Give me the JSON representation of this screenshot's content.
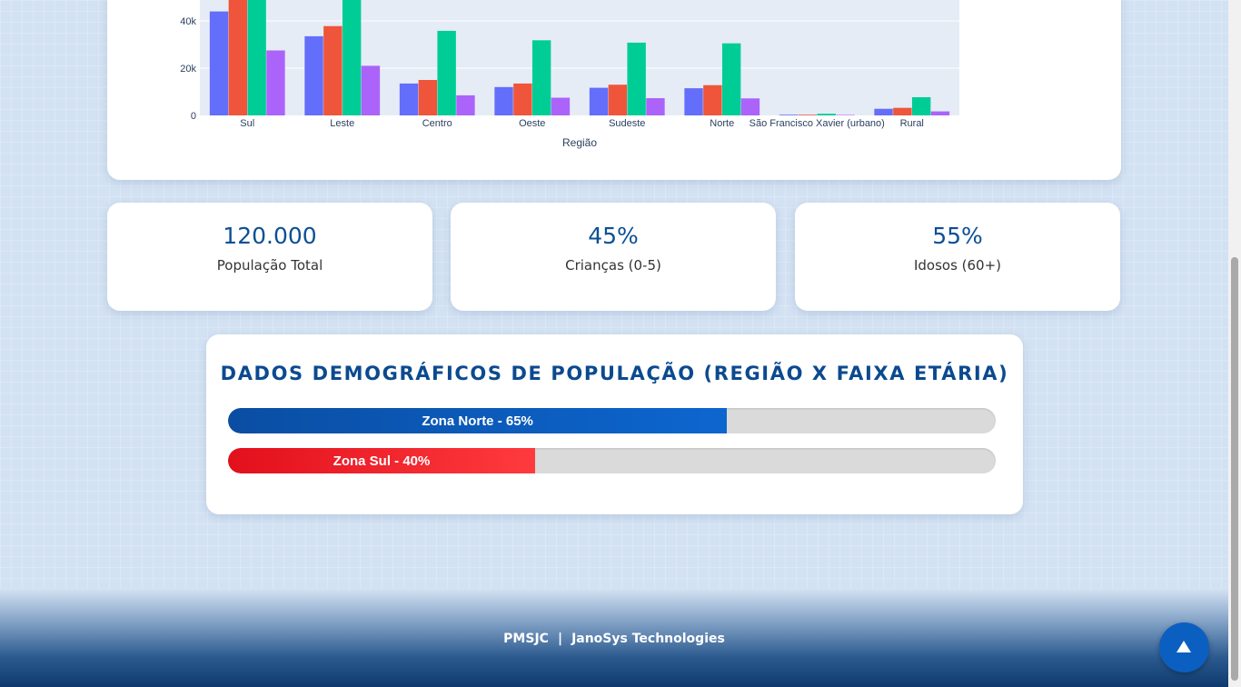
{
  "chart_data": {
    "type": "bar",
    "xlabel": "Região",
    "ylabel": "",
    "y_tick_labels": [
      "0",
      "20k",
      "40k"
    ],
    "ylim": [
      0,
      60000
    ],
    "grid": true,
    "categories": [
      "Sul",
      "Leste",
      "Centro",
      "Oeste",
      "Sudeste",
      "Norte",
      "São Francisco Xavier (urbano)",
      "Rural"
    ],
    "series": [
      {
        "color": "#636efa",
        "values": [
          44000,
          33500,
          13500,
          12000,
          11700,
          11500,
          300,
          2800
        ]
      },
      {
        "color": "#ef553b",
        "values": [
          50000,
          37800,
          15000,
          13500,
          13000,
          12800,
          300,
          3200
        ]
      },
      {
        "color": "#00cc96",
        "values": [
          50000,
          50000,
          35800,
          31800,
          30800,
          30500,
          700,
          7700
        ]
      },
      {
        "color": "#ab63fa",
        "values": [
          27500,
          21000,
          8500,
          7500,
          7300,
          7200,
          200,
          1700
        ]
      }
    ]
  },
  "stats": [
    {
      "value": "120.000",
      "label": "População Total"
    },
    {
      "value": "45%",
      "label": "Crianças (0-5)"
    },
    {
      "value": "55%",
      "label": "Idosos (60+)"
    }
  ],
  "demographics": {
    "title": "DADOS DEMOGRÁFICOS DE POPULAÇÃO (REGIÃO X FAIXA ETÁRIA)",
    "bars": [
      {
        "label": "Zona Norte - 65%",
        "percent": 65
      },
      {
        "label": "Zona Sul - 40%",
        "percent": 40
      }
    ]
  },
  "footer": {
    "org": "PMSJC",
    "separator": "|",
    "company": "JanoSys Technologies"
  },
  "scroll_top": {
    "icon": "arrow-up-icon"
  }
}
